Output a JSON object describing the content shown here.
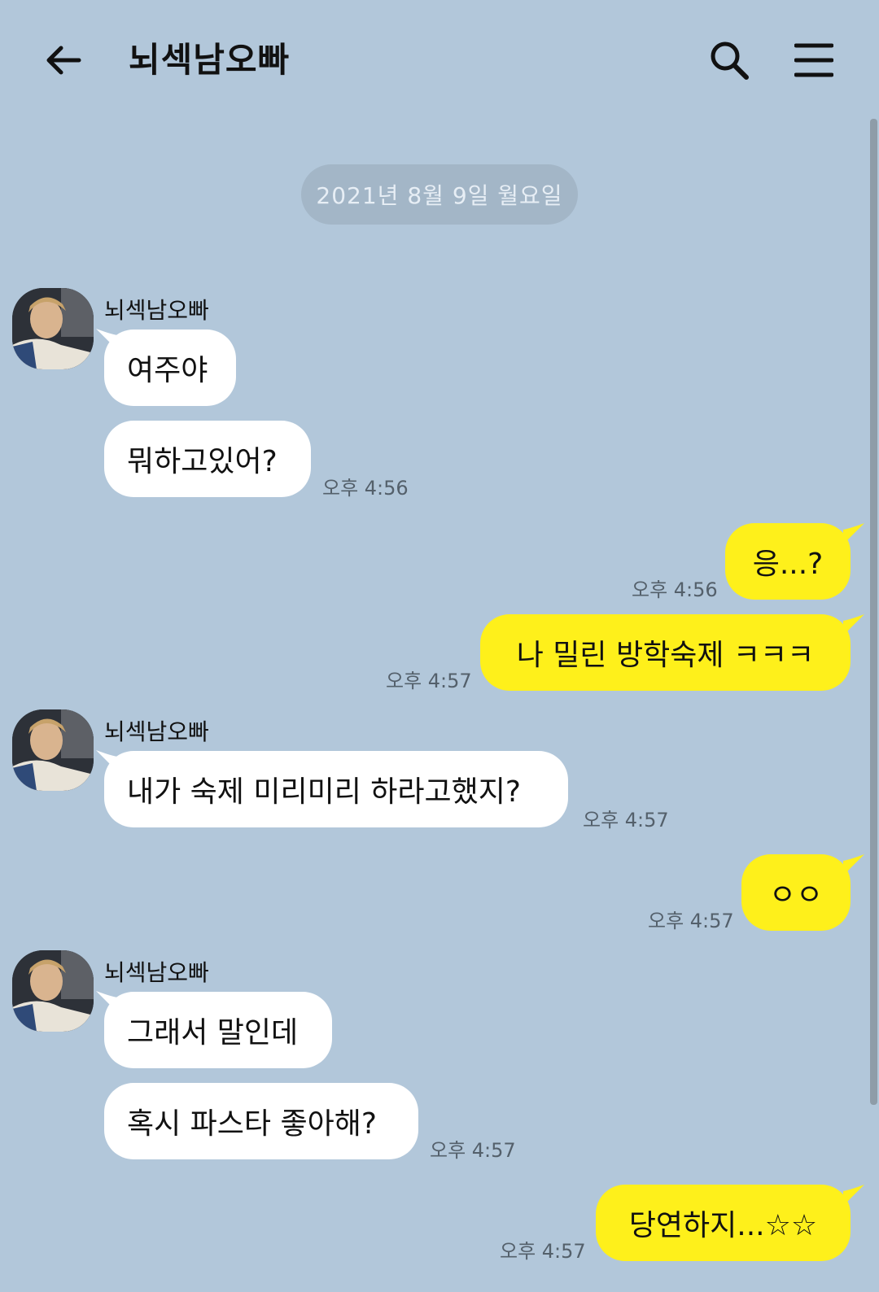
{
  "header": {
    "title": "뇌섹남오빠",
    "back_icon": "arrow-left-icon",
    "search_icon": "search-icon",
    "menu_icon": "hamburger-menu-icon"
  },
  "date_divider": "2021년 8월 9일 월요일",
  "colors": {
    "background": "#b2c7da",
    "incoming_bubble": "#ffffff",
    "outgoing_bubble": "#fef01b",
    "time_text": "#54606b"
  },
  "messages": [
    {
      "sender": "뇌섹남오빠",
      "text": "여주야",
      "direction": "in"
    },
    {
      "text": "뭐하고있어?",
      "time": "오후 4:56",
      "direction": "in"
    },
    {
      "text": "응...?",
      "time": "오후 4:56",
      "direction": "out"
    },
    {
      "text": "나 밀린 방학숙제 ㅋㅋㅋ",
      "time": "오후 4:57",
      "direction": "out"
    },
    {
      "sender": "뇌섹남오빠",
      "text": "내가 숙제 미리미리 하라고했지?",
      "time": "오후 4:57",
      "direction": "in"
    },
    {
      "text": "ㅇㅇ",
      "time": "오후 4:57",
      "direction": "out"
    },
    {
      "sender": "뇌섹남오빠",
      "text": "그래서 말인데",
      "direction": "in"
    },
    {
      "text": "혹시 파스타 좋아해?",
      "time": "오후 4:57",
      "direction": "in"
    },
    {
      "text": "당연하지...☆☆",
      "time": "오후 4:57",
      "direction": "out"
    }
  ]
}
